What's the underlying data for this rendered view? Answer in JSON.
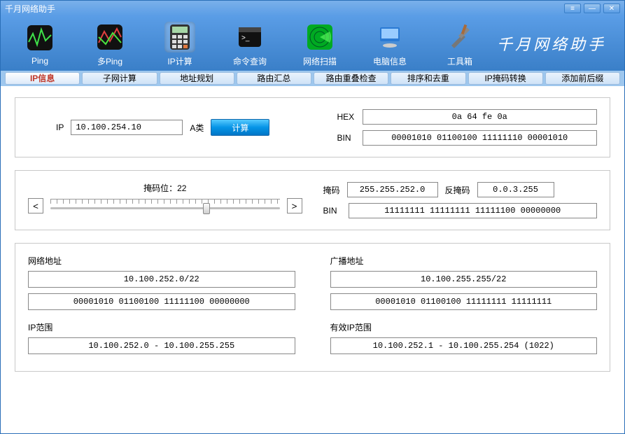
{
  "window": {
    "title": "千月网络助手"
  },
  "brand": "千月网络助手",
  "toolbar": [
    {
      "name": "ping",
      "label": "Ping"
    },
    {
      "name": "multiping",
      "label": "多Ping"
    },
    {
      "name": "ipcalc",
      "label": "IP计算"
    },
    {
      "name": "cmd",
      "label": "命令查询"
    },
    {
      "name": "netscan",
      "label": "网络扫描"
    },
    {
      "name": "pcinfo",
      "label": "电脑信息"
    },
    {
      "name": "toolbox",
      "label": "工具箱"
    }
  ],
  "subtabs": [
    "IP信息",
    "子网计算",
    "地址规划",
    "路由汇总",
    "路由重叠检查",
    "排序和去重",
    "IP掩码转换",
    "添加前后缀"
  ],
  "ip_panel": {
    "ip_label": "IP",
    "ip_value": "10.100.254.10",
    "ip_class": "A类",
    "calc_label": "计算",
    "hex_label": "HEX",
    "hex_value": "0a 64 fe 0a",
    "bin_label": "BIN",
    "bin_value": "00001010 01100100 11111110 00001010"
  },
  "mask_panel": {
    "mask_bits_label": "掩码位：",
    "mask_bits": "22",
    "mask_label": "掩码",
    "mask_value": "255.255.252.0",
    "wildcard_label": "反掩码",
    "wildcard_value": "0.0.3.255",
    "bin_label": "BIN",
    "bin_value": "11111111 11111111 11111100 00000000",
    "slider_percent": 68
  },
  "result_panel": {
    "net_addr_label": "网络地址",
    "net_addr": "10.100.252.0/22",
    "net_bin": "00001010 01100100 11111100 00000000",
    "bcast_label": "广播地址",
    "bcast": "10.100.255.255/22",
    "bcast_bin": "00001010 01100100 11111111 11111111",
    "ip_range_label": "IP范围",
    "ip_range": "10.100.252.0 - 10.100.255.255",
    "valid_range_label": "有效IP范围",
    "valid_range": "10.100.252.1 - 10.100.255.254 (1022)"
  }
}
